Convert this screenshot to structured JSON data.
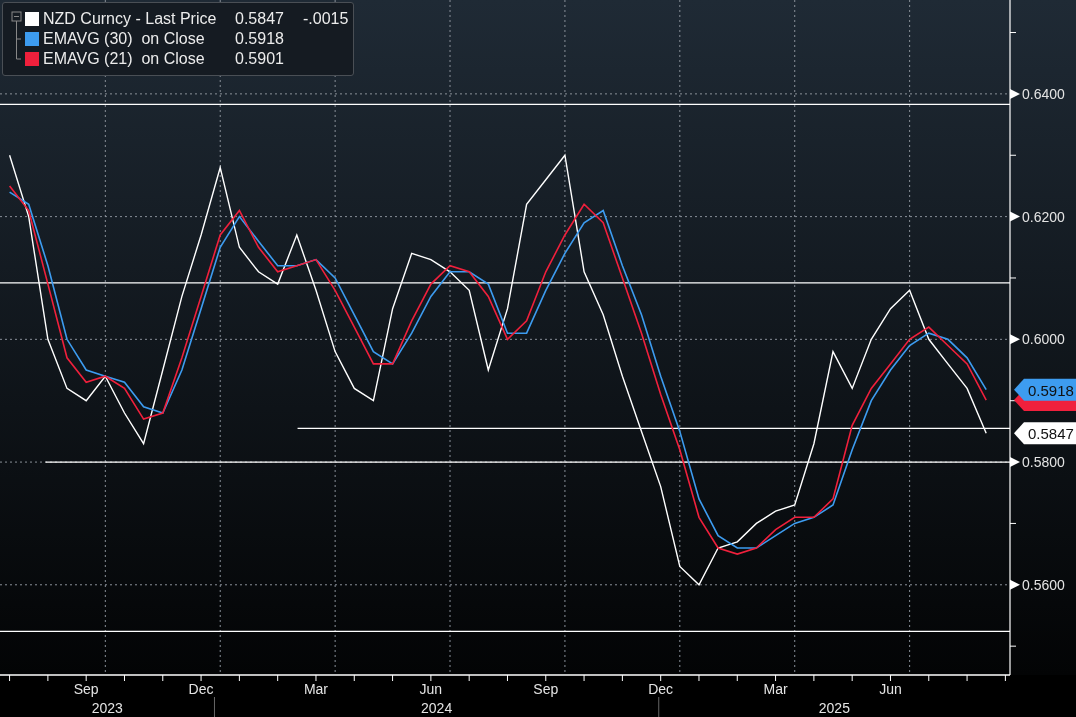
{
  "legend": {
    "items": [
      {
        "value": "0.5847",
        "change": "-.0015"
      },
      {
        "value": "0.5918"
      },
      {
        "value": "0.5901"
      }
    ]
  },
  "x_axis_years": [
    "2023",
    "2024",
    "2025"
  ],
  "chart_data": {
    "type": "line",
    "ylim": [
      0.5453,
      0.6553
    ],
    "categories": [
      null,
      null,
      null,
      null,
      "Sep",
      null,
      null,
      null,
      null,
      null,
      "Dec",
      null,
      null,
      null,
      null,
      null,
      "Mar",
      null,
      null,
      null,
      null,
      null,
      "Jun",
      null,
      null,
      null,
      null,
      null,
      "Sep",
      null,
      null,
      null,
      null,
      null,
      "Dec",
      null,
      null,
      null,
      null,
      null,
      "Mar",
      null,
      null,
      null,
      null,
      null,
      "Jun",
      null,
      null,
      null,
      null,
      null
    ],
    "series": [
      {
        "name": "NZD Curncy - Last Price",
        "color": "#ffffff",
        "values": [
          0.63,
          0.62,
          0.6,
          0.592,
          0.59,
          0.594,
          0.588,
          0.583,
          0.595,
          0.607,
          0.617,
          0.628,
          0.615,
          0.611,
          0.609,
          0.617,
          0.608,
          0.598,
          0.592,
          0.59,
          0.605,
          0.614,
          0.613,
          0.611,
          0.608,
          0.595,
          0.605,
          0.622,
          0.626,
          0.63,
          0.611,
          0.604,
          0.594,
          0.585,
          0.576,
          0.563,
          0.56,
          0.566,
          0.567,
          0.57,
          0.572,
          0.573,
          0.583,
          0.598,
          0.592,
          0.6,
          0.605,
          0.608,
          0.6,
          0.596,
          0.592,
          0.5847
        ]
      },
      {
        "name": "EMAVG (30)  on Close",
        "color": "#3d9cf0",
        "values": [
          0.624,
          0.622,
          0.612,
          0.6,
          0.595,
          0.594,
          0.593,
          0.589,
          0.588,
          0.595,
          0.605,
          0.615,
          0.62,
          0.616,
          0.612,
          0.612,
          0.613,
          0.61,
          0.604,
          0.598,
          0.596,
          0.601,
          0.607,
          0.611,
          0.611,
          0.609,
          0.601,
          0.601,
          0.608,
          0.614,
          0.619,
          0.621,
          0.612,
          0.604,
          0.594,
          0.585,
          0.574,
          0.568,
          0.566,
          0.566,
          0.568,
          0.57,
          0.571,
          0.573,
          0.582,
          0.59,
          0.595,
          0.599,
          0.601,
          0.6,
          0.597,
          0.5918
        ]
      },
      {
        "name": "EMAVG (21)  on Close",
        "color": "#f0203c",
        "values": [
          0.625,
          0.621,
          0.609,
          0.597,
          0.593,
          0.594,
          0.592,
          0.587,
          0.588,
          0.597,
          0.607,
          0.617,
          0.621,
          0.615,
          0.611,
          0.612,
          0.613,
          0.608,
          0.602,
          0.596,
          0.596,
          0.603,
          0.609,
          0.612,
          0.611,
          0.607,
          0.6,
          0.603,
          0.611,
          0.617,
          0.622,
          0.619,
          0.61,
          0.601,
          0.591,
          0.582,
          0.571,
          0.566,
          0.565,
          0.566,
          0.569,
          0.571,
          0.571,
          0.574,
          0.586,
          0.592,
          0.596,
          0.6,
          0.602,
          0.599,
          0.596,
          0.5901
        ]
      }
    ],
    "yticks": [
      {
        "value": 0.56,
        "label": "0.5600"
      },
      {
        "value": 0.58,
        "label": "0.5800"
      },
      {
        "value": 0.6,
        "label": "0.6000"
      },
      {
        "value": 0.62,
        "label": "0.6200"
      },
      {
        "value": 0.64,
        "label": "0.6400"
      }
    ],
    "grid": true
  },
  "price_tags": [
    {
      "label": "0.5918",
      "color": "#3d9cf0"
    },
    {
      "color": "#f0203c"
    },
    {
      "label": "0.5847",
      "color": "#ffffff"
    }
  ]
}
